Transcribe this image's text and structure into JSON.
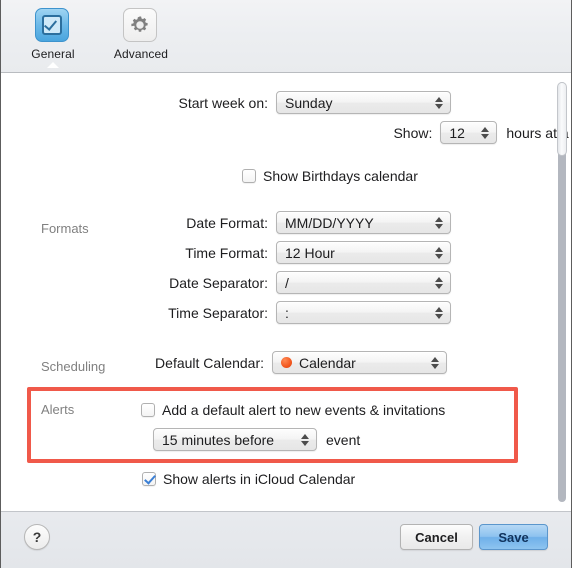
{
  "toolbar": {
    "tabs": [
      {
        "label": "General",
        "icon": "checkbox-icon",
        "selected": true
      },
      {
        "label": "Advanced",
        "icon": "gear-icon",
        "selected": false
      }
    ]
  },
  "form": {
    "start_week": {
      "label": "Start week on:",
      "value": "Sunday"
    },
    "show_hours": {
      "label": "Show:",
      "value": "12",
      "suffix": "hours at a time"
    },
    "show_birthdays": {
      "label": "Show Birthdays calendar",
      "checked": false
    }
  },
  "formats": {
    "group_label": "Formats",
    "rows": [
      {
        "label": "Date Format:",
        "value": "MM/DD/YYYY"
      },
      {
        "label": "Time Format:",
        "value": "12 Hour"
      },
      {
        "label": "Date Separator:",
        "value": "/"
      },
      {
        "label": "Time Separator:",
        "value": ":"
      }
    ]
  },
  "scheduling": {
    "group_label": "Scheduling",
    "default_calendar": {
      "label": "Default Calendar:",
      "value": "Calendar",
      "dot_color": "#f2571f"
    }
  },
  "alerts": {
    "group_label": "Alerts",
    "default_alert": {
      "label": "Add a default alert to new events & invitations",
      "checked": false
    },
    "alert_time": {
      "value": "15 minutes before",
      "suffix": "event"
    },
    "show_icloud_alerts": {
      "label": "Show alerts in iCloud Calendar",
      "checked": true
    },
    "highlight_color": "#f0594a"
  },
  "footer": {
    "help_label": "?",
    "cancel_label": "Cancel",
    "save_label": "Save"
  }
}
